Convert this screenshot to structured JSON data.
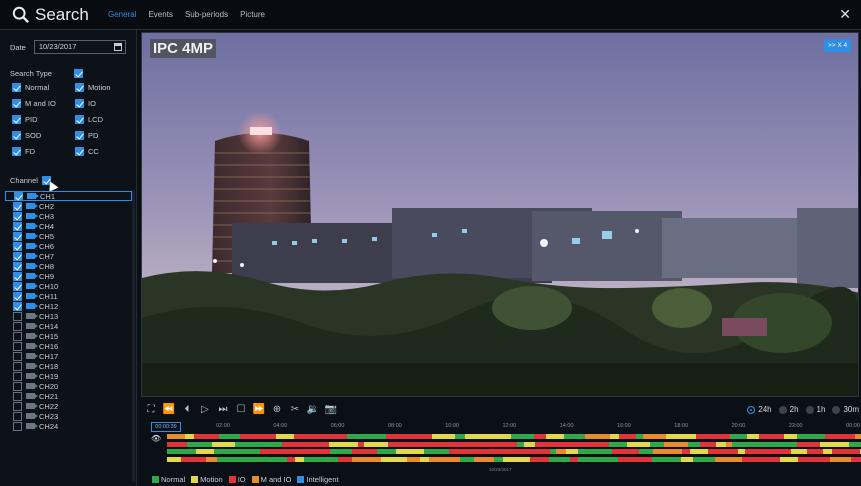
{
  "header": {
    "title": "Search",
    "tabs": [
      {
        "label": "General",
        "active": true
      },
      {
        "label": "Events",
        "active": false
      },
      {
        "label": "Sub-periods",
        "active": false
      },
      {
        "label": "Picture",
        "active": false
      }
    ],
    "accent_color": "#2f8ee6"
  },
  "sidebar": {
    "date_label": "Date",
    "date_value": "10/23/2017",
    "search_type_label": "Search Type",
    "search_type_all_checked": true,
    "search_types": [
      {
        "label": "Normal",
        "checked": true
      },
      {
        "label": "Motion",
        "checked": true
      },
      {
        "label": "M and IO",
        "checked": true
      },
      {
        "label": "IO",
        "checked": true
      },
      {
        "label": "PID",
        "checked": true
      },
      {
        "label": "LCD",
        "checked": true
      },
      {
        "label": "SOD",
        "checked": true
      },
      {
        "label": "PD",
        "checked": true
      },
      {
        "label": "FD",
        "checked": true
      },
      {
        "label": "CC",
        "checked": true
      }
    ],
    "channel_label": "Channel",
    "channels": [
      {
        "label": "CH1",
        "checked": true
      },
      {
        "label": "CH2",
        "checked": true
      },
      {
        "label": "CH3",
        "checked": true
      },
      {
        "label": "CH4",
        "checked": true
      },
      {
        "label": "CH5",
        "checked": true
      },
      {
        "label": "CH6",
        "checked": true
      },
      {
        "label": "CH7",
        "checked": true
      },
      {
        "label": "CH8",
        "checked": true
      },
      {
        "label": "CH9",
        "checked": true
      },
      {
        "label": "CH10",
        "checked": true
      },
      {
        "label": "CH11",
        "checked": true
      },
      {
        "label": "CH12",
        "checked": true
      },
      {
        "label": "CH13",
        "checked": false
      },
      {
        "label": "CH14",
        "checked": false
      },
      {
        "label": "CH15",
        "checked": false
      },
      {
        "label": "CH16",
        "checked": false
      },
      {
        "label": "CH17",
        "checked": false
      },
      {
        "label": "CH18",
        "checked": false
      },
      {
        "label": "CH19",
        "checked": false
      },
      {
        "label": "CH20",
        "checked": false
      },
      {
        "label": "CH21",
        "checked": false
      },
      {
        "label": "CH22",
        "checked": false
      },
      {
        "label": "CH23",
        "checked": false
      },
      {
        "label": "CH24",
        "checked": false
      }
    ]
  },
  "video": {
    "camera_label": "IPC 4MP",
    "speed_label": ">> X 4"
  },
  "controls": {
    "icons": [
      "fullscreen-icon",
      "rewind-icon",
      "step-back-icon",
      "play-icon",
      "step-forward-icon",
      "stop-icon",
      "fast-forward-icon",
      "zoom-in-icon",
      "clip-icon",
      "audio-icon",
      "snapshot-icon"
    ],
    "zoom_options": [
      {
        "label": "24h",
        "selected": true
      },
      {
        "label": "2h",
        "selected": false
      },
      {
        "label": "1h",
        "selected": false
      },
      {
        "label": "30m",
        "selected": false
      }
    ]
  },
  "timeline": {
    "current_time": "00:00:39",
    "ticks": [
      "02:00",
      "04:00",
      "06:00",
      "08:00",
      "10:00",
      "12:00",
      "14:00",
      "16:00",
      "18:00",
      "20:00",
      "22:00",
      "00:00"
    ],
    "date_stamp": "10/23/2017"
  },
  "legend": [
    {
      "label": "Normal",
      "color": "#2ea84a"
    },
    {
      "label": "Motion",
      "color": "#e3d84a"
    },
    {
      "label": "IO",
      "color": "#e0333a"
    },
    {
      "label": "M and IO",
      "color": "#e98a2b"
    },
    {
      "label": "Intelligent",
      "color": "#2f8ee6"
    }
  ]
}
